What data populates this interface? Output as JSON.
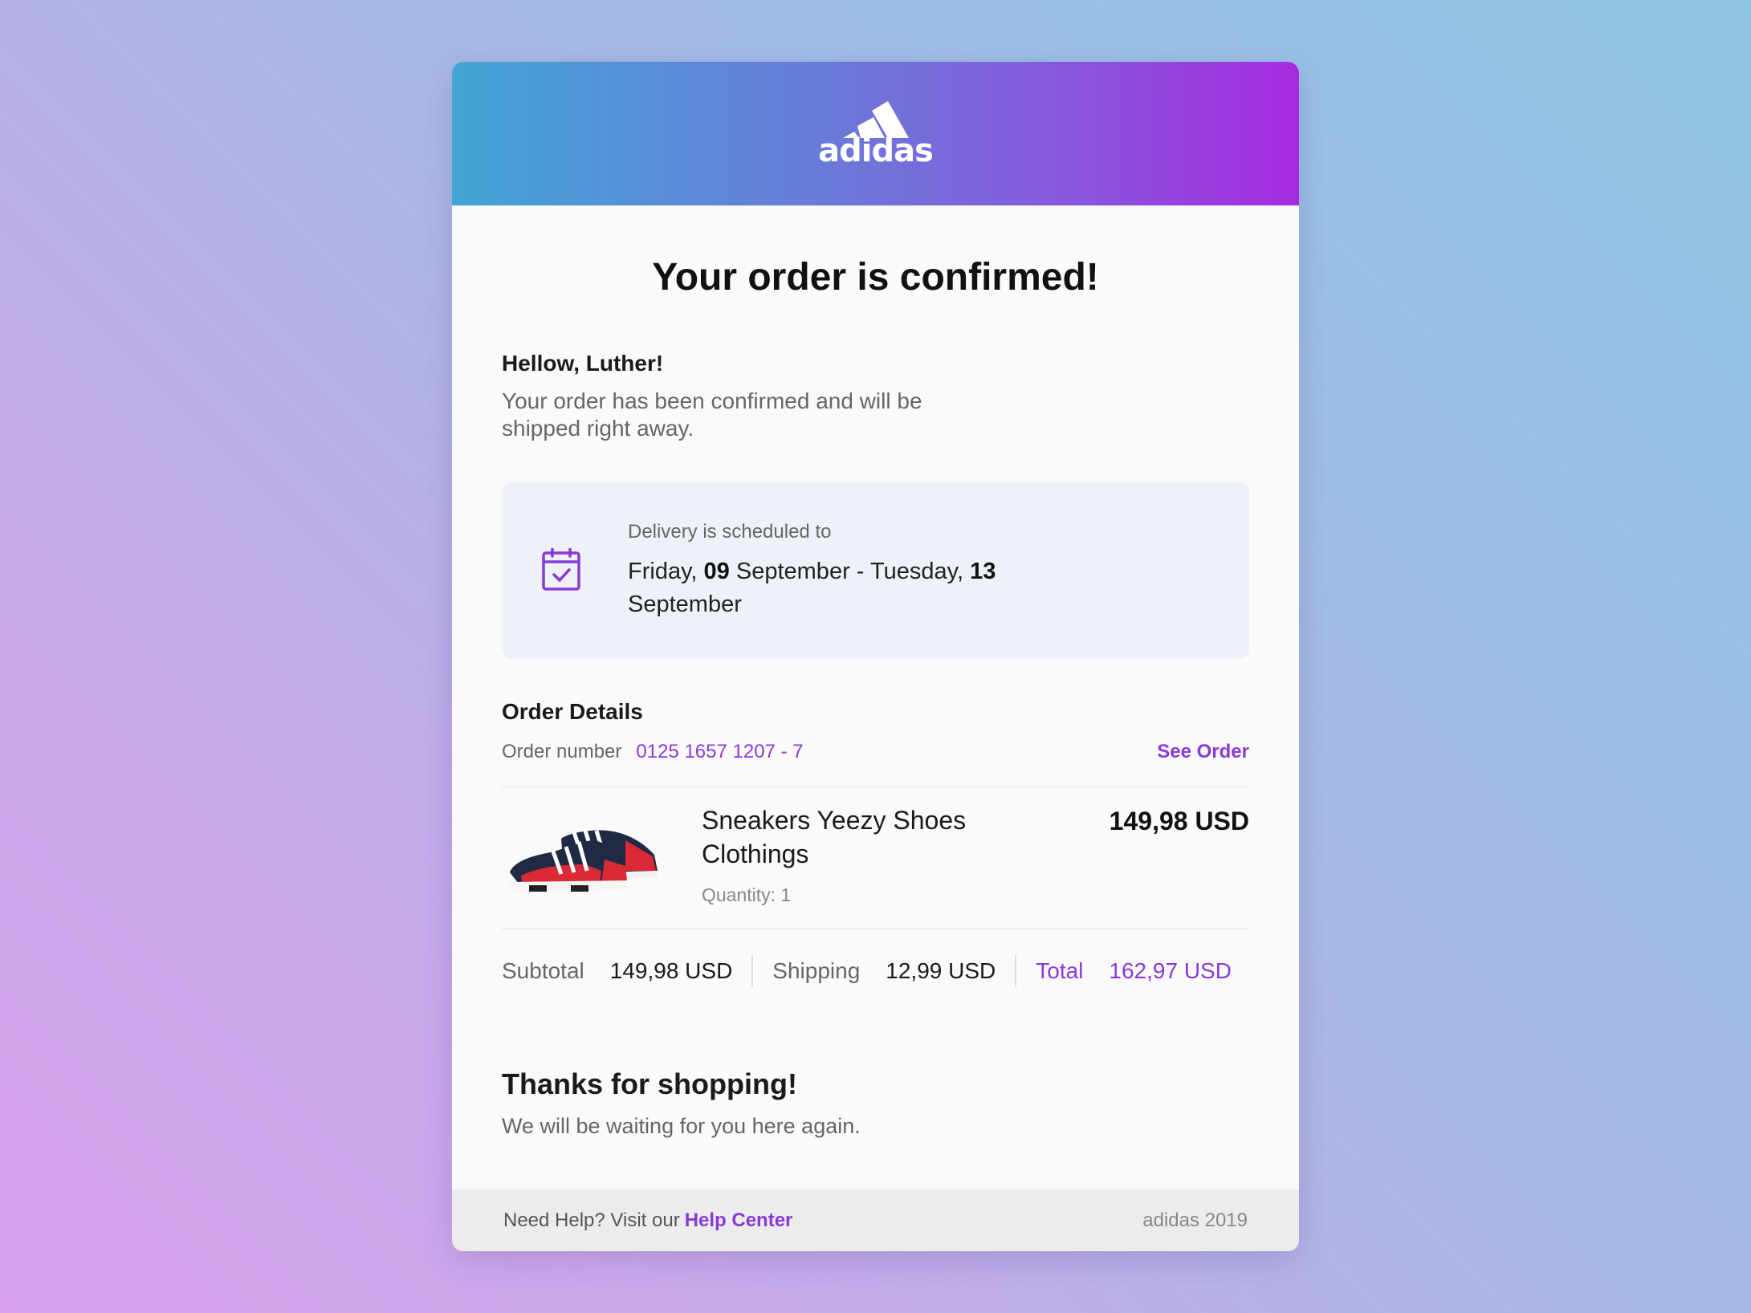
{
  "header": {
    "logo_text": "adidas",
    "logo_icon": "adidas-logo-icon"
  },
  "title": "Your order is confirmed!",
  "greeting": "Hellow, Luther!",
  "intro": "Your order has been confirmed and will be shipped right away.",
  "delivery": {
    "label": "Delivery is scheduled to",
    "day1": "Friday, ",
    "date1": "09",
    "month1_and_day2": " September - Tuesday, ",
    "date2": "13",
    "month2": "September",
    "icon": "calendar-check-icon"
  },
  "order_details": {
    "title": "Order Details",
    "number_label": "Order number",
    "number": "0125 1657 1207 - 7",
    "see_order": "See Order"
  },
  "item": {
    "name": "Sneakers Yeezy Shoes Clothings",
    "quantity": "Quantity: 1",
    "price": "149,98 USD",
    "image_icon": "sneaker-image"
  },
  "totals": {
    "subtotal_label": "Subtotal",
    "subtotal_value": "149,98 USD",
    "shipping_label": "Shipping",
    "shipping_value": "12,99 USD",
    "total_label": "Total",
    "total_value": "162,97 USD"
  },
  "thanks": {
    "title": "Thanks for shopping!",
    "text": "We will be waiting for you here again."
  },
  "footer": {
    "help_prefix": "Need Help? Visit our",
    "help_link": "Help Center",
    "copyright": "adidas 2019"
  },
  "colors": {
    "accent": "#8a3ad8",
    "header_start": "#42a5d5",
    "header_end": "#a52be0"
  }
}
